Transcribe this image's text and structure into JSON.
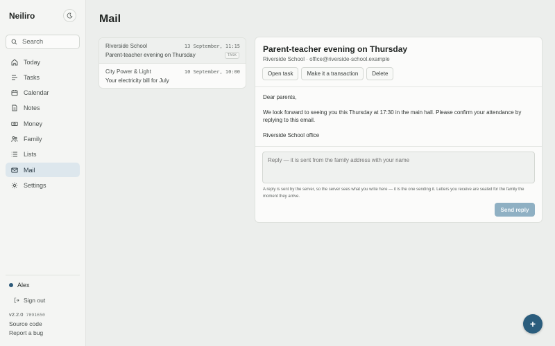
{
  "app": {
    "brand": "Neiliro",
    "page_title": "Mail"
  },
  "sidebar": {
    "search_label": "Search",
    "items": [
      {
        "label": "Today",
        "icon": "home-icon"
      },
      {
        "label": "Tasks",
        "icon": "tasks-icon"
      },
      {
        "label": "Calendar",
        "icon": "calendar-icon"
      },
      {
        "label": "Notes",
        "icon": "notes-icon"
      },
      {
        "label": "Money",
        "icon": "money-icon"
      },
      {
        "label": "Family",
        "icon": "family-icon"
      },
      {
        "label": "Lists",
        "icon": "lists-icon"
      },
      {
        "label": "Mail",
        "icon": "mail-icon",
        "active": true
      },
      {
        "label": "Settings",
        "icon": "settings-icon"
      }
    ],
    "user": "Alex",
    "signout": "Sign out",
    "version": "v2.2.0",
    "commit": "7091650",
    "source_code": "Source code",
    "report_bug": "Report a bug"
  },
  "mail_list": [
    {
      "sender": "Riverside School",
      "date": "13 September, 11:15",
      "subject": "Parent-teacher evening on Thursday",
      "tag": "TASK",
      "selected": true
    },
    {
      "sender": "City Power & Light",
      "date": "10 September, 10:00",
      "subject": "Your electricity bill for July",
      "tag": "",
      "selected": false
    }
  ],
  "reader": {
    "subject": "Parent-teacher evening on Thursday",
    "from": "Riverside School · office@riverside-school.example",
    "actions": {
      "open_task": "Open task",
      "make_transaction": "Make it a transaction",
      "delete": "Delete"
    },
    "body": [
      "Dear parents,",
      "We look forward to seeing you this Thursday at 17:30 in the main hall. Please confirm your attendance by replying to this email.",
      "Riverside School office"
    ],
    "reply_placeholder": "Reply — it is sent from the family address with your name",
    "note": "A reply is sent by the server, so the server sees what you write here — it is the one sending it. Letters you receive are sealed for the family the moment they arrive.",
    "send_label": "Send reply"
  },
  "fab_label": "+",
  "colors": {
    "accent": "#2b5d7d",
    "active_nav": "#dde7ed",
    "send_button": "#8fb0c3"
  }
}
